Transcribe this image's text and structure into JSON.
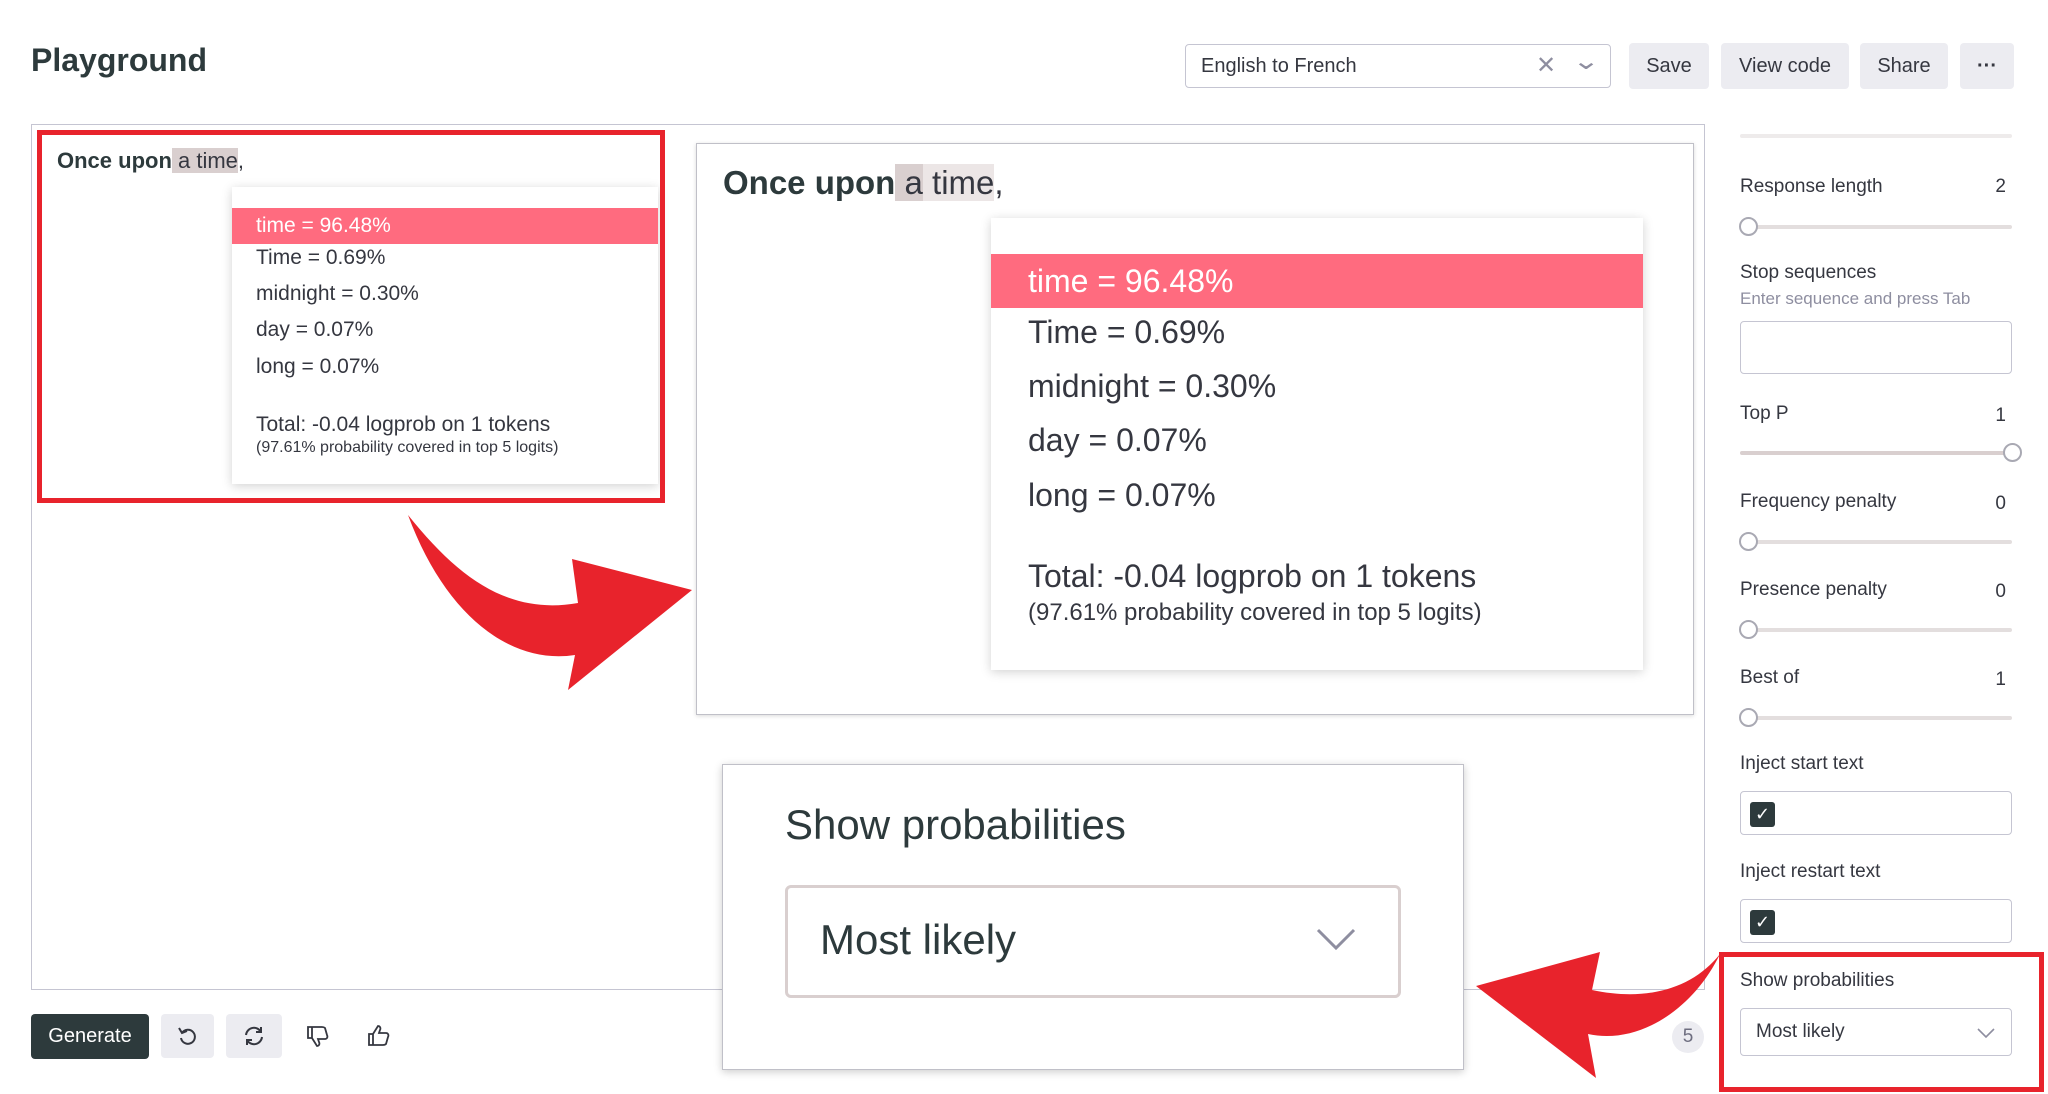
{
  "header": {
    "title": "Playground",
    "preset": "English to French",
    "buttons": {
      "save": "Save",
      "view_code": "View code",
      "share": "Share",
      "more": "···"
    }
  },
  "prompt": {
    "bold": "Once upon",
    "highlighted": " a time",
    "tail": ","
  },
  "logprobs": {
    "tokens": [
      "time = 96.48%",
      "Time = 0.69%",
      "midnight = 0.30%",
      "day = 0.07%",
      "long = 0.07%"
    ],
    "total": "Total: -0.04 logprob on 1 tokens",
    "coverage": "(97.61% probability covered in top 5 logits)"
  },
  "zoom_prompt": {
    "bold": "Once upon",
    "highlighted": " a",
    "time": " time",
    "tail": ","
  },
  "zoom_setting": {
    "label": "Show probabilities",
    "value": "Most likely"
  },
  "sidebar": {
    "response_length": {
      "label": "Response length",
      "value": "2"
    },
    "stop_sequences": {
      "label": "Stop sequences",
      "hint": "Enter sequence and press Tab"
    },
    "top_p": {
      "label": "Top P",
      "value": "1",
      "level": 1
    },
    "frequency_penalty": {
      "label": "Frequency penalty",
      "value": "0",
      "level": 0
    },
    "presence_penalty": {
      "label": "Presence penalty",
      "value": "0",
      "level": 0
    },
    "best_of": {
      "label": "Best of",
      "value": "1",
      "level": 0
    },
    "inject_start": {
      "label": "Inject start text",
      "checked": true
    },
    "inject_restart": {
      "label": "Inject restart text",
      "checked": true
    },
    "show_probabilities": {
      "label": "Show probabilities",
      "value": "Most likely"
    }
  },
  "footer": {
    "generate": "Generate",
    "token_count": "5"
  },
  "icons": {
    "preset_clear": "close-icon",
    "preset_dropdown": "chevron-down-icon",
    "undo": "undo-icon",
    "regenerate": "refresh-icon",
    "thumbs_down": "thumbs-down-icon",
    "thumbs_up": "thumbs-up-icon",
    "checkbox": "check-icon",
    "arrow": "curved-arrow-icon"
  },
  "colors": {
    "accent": "#2d3a3c",
    "top_token": "#ff6b7f",
    "annotation_red": "#e8232c",
    "highlight": "#d9cfcf"
  }
}
